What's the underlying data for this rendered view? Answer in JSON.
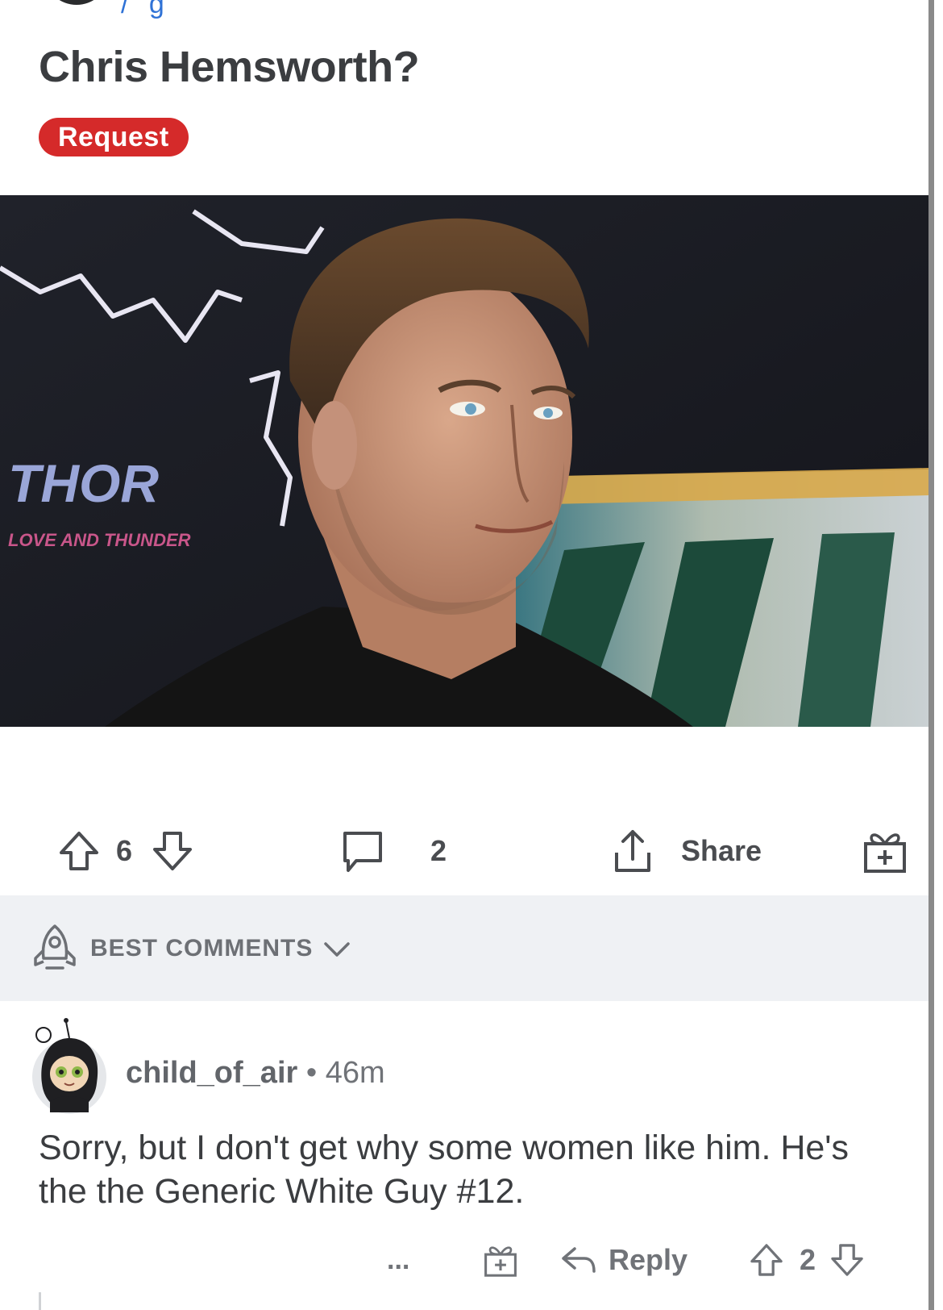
{
  "post": {
    "title": "Chris Hemsworth?",
    "flair": "Request",
    "image": {
      "logo_title": "THOR",
      "logo_subtitle": "LOVE AND THUNDER"
    },
    "upvotes": "6",
    "comments": "2",
    "share_label": "Share"
  },
  "comments_header": {
    "sort_label": "BEST COMMENTS"
  },
  "comment": {
    "username": "child_of_air",
    "separator": "•",
    "time": "46m",
    "body": "Sorry, but I don't get why some women like him. He's the the Generic White Guy #12.",
    "more": "...",
    "reply_label": "Reply",
    "score": "2"
  },
  "colors": {
    "flair_bg": "#d52a2a",
    "text": "#3b3d40",
    "meta": "#707378",
    "band": "#eff1f4"
  }
}
